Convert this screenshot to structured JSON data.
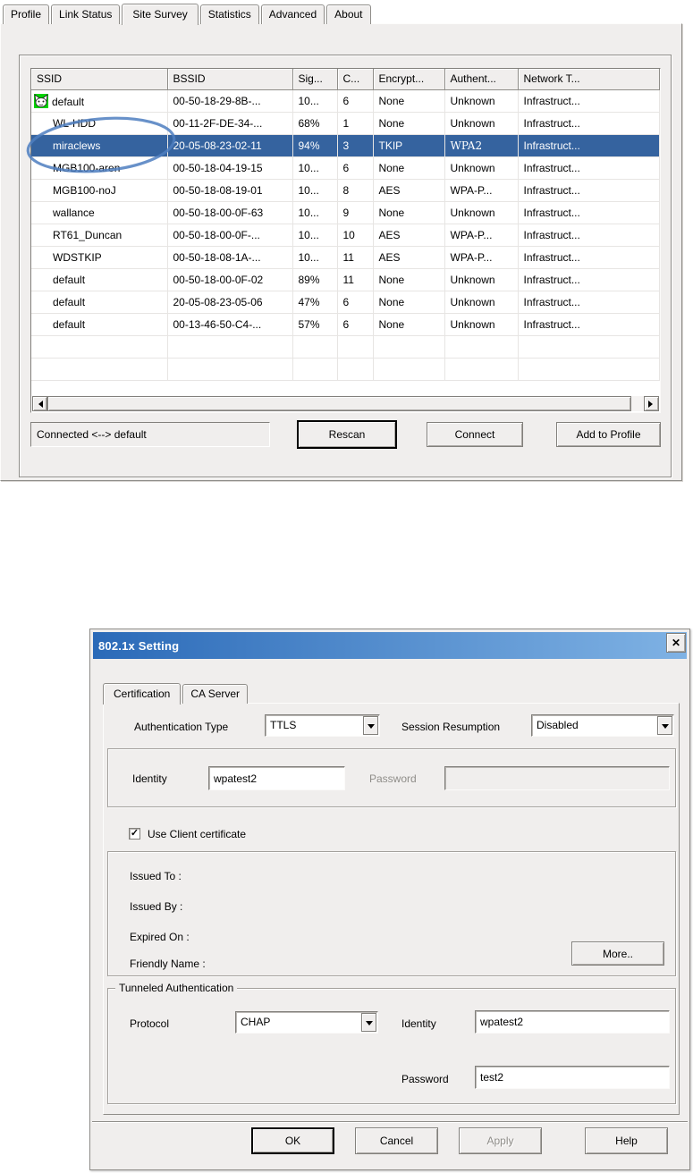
{
  "colors": {
    "selection_bg": "#35639f",
    "chrome_bg": "#f0eeed"
  },
  "main_tabs": {
    "items": [
      {
        "label": "Profile",
        "active": false
      },
      {
        "label": "Link Status",
        "active": false
      },
      {
        "label": "Site Survey",
        "active": true
      },
      {
        "label": "Statistics",
        "active": false
      },
      {
        "label": "Advanced",
        "active": false
      },
      {
        "label": "About",
        "active": false
      }
    ]
  },
  "site_survey": {
    "columns": [
      {
        "key": "ssid",
        "label": "SSID",
        "width": 152
      },
      {
        "key": "bssid",
        "label": "BSSID",
        "width": 140
      },
      {
        "key": "signal",
        "label": "Sig...",
        "width": 50
      },
      {
        "key": "channel",
        "label": "C...",
        "width": 40
      },
      {
        "key": "encryption",
        "label": "Encrypt...",
        "width": 80
      },
      {
        "key": "authentication",
        "label": "Authent...",
        "width": 82
      },
      {
        "key": "network_type",
        "label": "Network T...",
        "width": 158
      }
    ],
    "rows": [
      {
        "ssid": "default",
        "bssid": "00-50-18-29-8B-...",
        "signal": "10...",
        "channel": "6",
        "encryption": "None",
        "authentication": "Unknown",
        "network_type": "Infrastruct...",
        "icon": "connected-station-icon",
        "selected": false
      },
      {
        "ssid": "WL-HDD",
        "bssid": "00-11-2F-DE-34-...",
        "signal": "68%",
        "channel": "1",
        "encryption": "None",
        "authentication": "Unknown",
        "network_type": "Infrastruct...",
        "selected": false
      },
      {
        "ssid": "miraclews",
        "bssid": "20-05-08-23-02-11",
        "signal": "94%",
        "channel": "3",
        "encryption": "TKIP",
        "authentication": "WPA2",
        "network_type": "Infrastruct...",
        "selected": true
      },
      {
        "ssid": "MGB100-aren",
        "bssid": "00-50-18-04-19-15",
        "signal": "10...",
        "channel": "6",
        "encryption": "None",
        "authentication": "Unknown",
        "network_type": "Infrastruct...",
        "selected": false
      },
      {
        "ssid": "MGB100-noJ",
        "bssid": "00-50-18-08-19-01",
        "signal": "10...",
        "channel": "8",
        "encryption": "AES",
        "authentication": "WPA-P...",
        "network_type": "Infrastruct...",
        "selected": false
      },
      {
        "ssid": "wallance",
        "bssid": "00-50-18-00-0F-63",
        "signal": "10...",
        "channel": "9",
        "encryption": "None",
        "authentication": "Unknown",
        "network_type": "Infrastruct...",
        "selected": false
      },
      {
        "ssid": "RT61_Duncan",
        "bssid": "00-50-18-00-0F-...",
        "signal": "10...",
        "channel": "10",
        "encryption": "AES",
        "authentication": "WPA-P...",
        "network_type": "Infrastruct...",
        "selected": false
      },
      {
        "ssid": "WDSTKIP",
        "bssid": "00-50-18-08-1A-...",
        "signal": "10...",
        "channel": "11",
        "encryption": "AES",
        "authentication": "WPA-P...",
        "network_type": "Infrastruct...",
        "selected": false
      },
      {
        "ssid": "default",
        "bssid": "00-50-18-00-0F-02",
        "signal": "89%",
        "channel": "11",
        "encryption": "None",
        "authentication": "Unknown",
        "network_type": "Infrastruct...",
        "selected": false
      },
      {
        "ssid": "default",
        "bssid": "20-05-08-23-05-06",
        "signal": "47%",
        "channel": "6",
        "encryption": "None",
        "authentication": "Unknown",
        "network_type": "Infrastruct...",
        "selected": false
      },
      {
        "ssid": "default",
        "bssid": "00-13-46-50-C4-...",
        "signal": "57%",
        "channel": "6",
        "encryption": "None",
        "authentication": "Unknown",
        "network_type": "Infrastruct...",
        "selected": false
      }
    ],
    "empty_row_count": 2,
    "status_text": "Connected <--> default",
    "buttons": [
      {
        "label": "Rescan",
        "default": true,
        "disabled": false
      },
      {
        "label": "Connect",
        "default": false,
        "disabled": false
      },
      {
        "label": "Add to Profile",
        "default": false,
        "disabled": false
      }
    ],
    "annotation_color": "#4d7ebf"
  },
  "dialog": {
    "title": "802.1x Setting",
    "close_icon": "✕",
    "titlebar_colors": {
      "left": "#2b6ab8",
      "right": "#7fb2e4"
    },
    "tabs": [
      {
        "label": "Certification",
        "active": true
      },
      {
        "label": "CA Server",
        "active": false
      }
    ],
    "auth_type": {
      "label": "Authentication Type",
      "value": "TTLS"
    },
    "session_resumption": {
      "label": "Session Resumption",
      "value": "Disabled"
    },
    "identity": {
      "label": "Identity",
      "value": "wpatest2"
    },
    "password": {
      "label": "Password",
      "value": "",
      "disabled": true
    },
    "use_client_certificate": {
      "label": "Use Client certificate",
      "checked": true,
      "check_icon": "✓"
    },
    "certificate": {
      "issued_to_label": "Issued To :",
      "issued_by_label": "Issued By :",
      "expired_on_label": "Expired On :",
      "friendly_name_label": "Friendly Name :",
      "more_button_label": "More.."
    },
    "tunneled_auth": {
      "group_title": "Tunneled Authentication",
      "protocol": {
        "label": "Protocol",
        "value": "CHAP"
      },
      "identity": {
        "label": "Identity",
        "value": "wpatest2"
      },
      "password": {
        "label": "Password",
        "value": "test2"
      }
    },
    "buttons": [
      {
        "label": "OK",
        "default": true,
        "disabled": false
      },
      {
        "label": "Cancel",
        "default": false,
        "disabled": false
      },
      {
        "label": "Apply",
        "default": false,
        "disabled": true
      },
      {
        "label": "Help",
        "default": false,
        "disabled": false
      }
    ]
  }
}
